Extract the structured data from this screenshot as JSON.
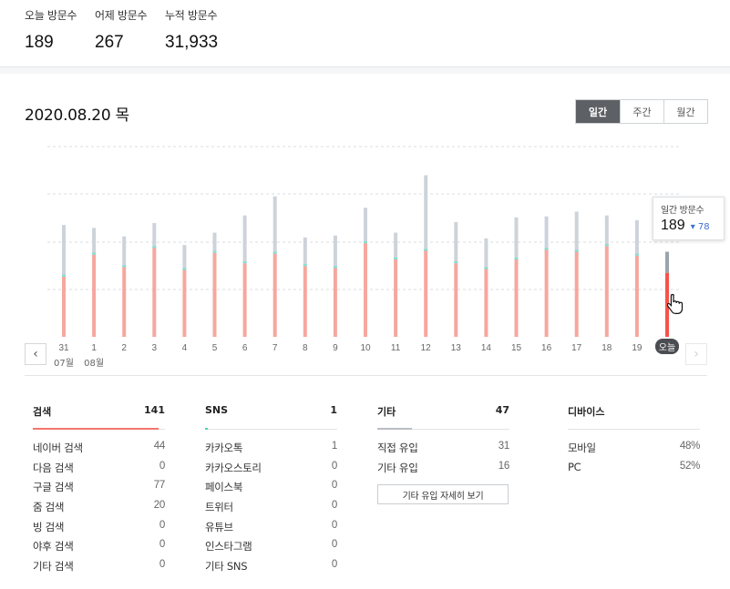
{
  "stats": [
    {
      "label": "오늘 방문수",
      "value": "189"
    },
    {
      "label": "어제 방문수",
      "value": "267"
    },
    {
      "label": "누적 방문수",
      "value": "31,933"
    }
  ],
  "date_title": "2020.08.20 목",
  "toggle": {
    "daily": "일간",
    "weekly": "주간",
    "monthly": "월간",
    "active": "일간"
  },
  "tooltip": {
    "label": "일간 방문수",
    "value": "189",
    "delta": "78"
  },
  "month_labels": {
    "prev": "07월",
    "current": "08월"
  },
  "today_label": "오늘",
  "colors": {
    "bar_top": "#cdd3d9",
    "bar_bottom": "#f6a79e",
    "bar_mid": "#7ee0cf",
    "today_top": "#9ba3ac",
    "today_bottom": "#f5534a",
    "accent_search": "#f5776d",
    "accent_sns": "#45d5b7"
  },
  "chart_data": {
    "type": "bar",
    "categories": [
      "31",
      "1",
      "2",
      "3",
      "4",
      "5",
      "6",
      "7",
      "8",
      "9",
      "10",
      "11",
      "12",
      "13",
      "14",
      "15",
      "16",
      "17",
      "18",
      "19",
      "오늘"
    ],
    "series": [
      {
        "values": [
          63,
          86,
          73,
          93,
          70,
          88,
          77,
          87,
          74,
          72,
          98,
          81,
          90,
          77,
          71,
          81,
          91,
          89,
          95,
          85,
          67
        ]
      },
      {
        "values": [
          54,
          28,
          32,
          26,
          26,
          21,
          50,
          60,
          30,
          34,
          37,
          28,
          79,
          43,
          32,
          44,
          35,
          42,
          32,
          37,
          22
        ]
      }
    ],
    "highlight": "오늘",
    "ylim": [
      0,
      200
    ],
    "grid": true
  },
  "panels": [
    {
      "title": "검색",
      "total": "141",
      "accent": "search",
      "rows": [
        {
          "label": "네이버 검색",
          "value": "44"
        },
        {
          "label": "다음 검색",
          "value": "0"
        },
        {
          "label": "구글 검색",
          "value": "77"
        },
        {
          "label": "줌 검색",
          "value": "20"
        },
        {
          "label": "빙 검색",
          "value": "0"
        },
        {
          "label": "야후 검색",
          "value": "0"
        },
        {
          "label": "기타 검색",
          "value": "0"
        }
      ]
    },
    {
      "title": "SNS",
      "total": "1",
      "accent": "sns",
      "rows": [
        {
          "label": "카카오톡",
          "value": "1"
        },
        {
          "label": "카카오스토리",
          "value": "0"
        },
        {
          "label": "페이스북",
          "value": "0"
        },
        {
          "label": "트위터",
          "value": "0"
        },
        {
          "label": "유튜브",
          "value": "0"
        },
        {
          "label": "인스타그램",
          "value": "0"
        },
        {
          "label": "기타 SNS",
          "value": "0"
        }
      ]
    },
    {
      "title": "기타",
      "total": "47",
      "accent": "other",
      "rows": [
        {
          "label": "직접 유입",
          "value": "31"
        },
        {
          "label": "기타 유입",
          "value": "16"
        }
      ]
    },
    {
      "title": "디바이스",
      "total": "",
      "accent": "none",
      "rows": [
        {
          "label": "모바일",
          "value": "48%"
        },
        {
          "label": "PC",
          "value": "52%"
        }
      ]
    }
  ],
  "detail_button": "기타 유입 자세히 보기"
}
